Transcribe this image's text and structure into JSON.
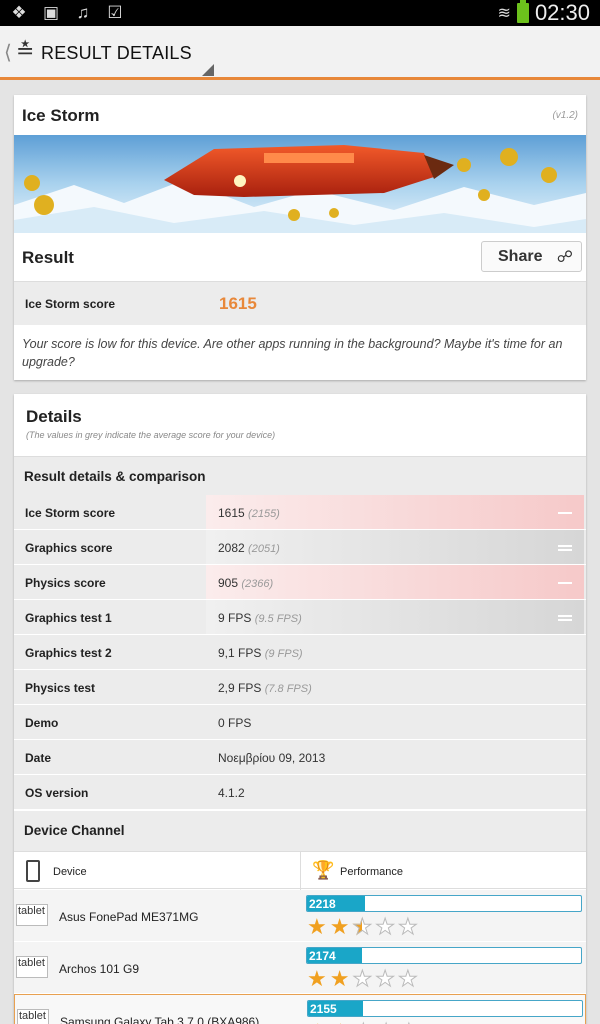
{
  "status_bar": {
    "left_icons": [
      "dropbox-icon",
      "gallery-icon",
      "music-icon",
      "checkbag-icon"
    ],
    "time": "02:30"
  },
  "action_bar": {
    "title": "RESULT DETAILS"
  },
  "test_card": {
    "title": "Ice Storm",
    "version": "(v1.2)",
    "result_label": "Result",
    "share_label": "Share",
    "score_label": "Ice Storm score",
    "score_value": "1615",
    "message": "Your score is low for this device. Are other apps running in the background? Maybe it's time for an upgrade?"
  },
  "details": {
    "title": "Details",
    "subtitle": "(The values in grey indicate the average score for your device)",
    "section_title": "Result details & comparison",
    "rows": [
      {
        "label": "Ice Storm score",
        "value": "1615",
        "avg": "(2155)"
      },
      {
        "label": "Graphics score",
        "value": "2082",
        "avg": "(2051)"
      },
      {
        "label": "Physics score",
        "value": "905",
        "avg": "(2366)"
      },
      {
        "label": "Graphics test 1",
        "value": "9 FPS",
        "avg": "(9.5 FPS)"
      },
      {
        "label": "Graphics test 2",
        "value": "9,1 FPS",
        "avg": "(9 FPS)"
      },
      {
        "label": "Physics test",
        "value": "2,9 FPS",
        "avg": "(7.8 FPS)"
      },
      {
        "label": "Demo",
        "value": "0 FPS",
        "avg": ""
      },
      {
        "label": "Date",
        "value": "Νοεμβρίου 09, 2013",
        "avg": ""
      },
      {
        "label": "OS version",
        "value": "4.1.2",
        "avg": ""
      }
    ]
  },
  "device_channel": {
    "title": "Device Channel",
    "col_device": "Device",
    "col_performance": "Performance",
    "thumb_alt": "tablet",
    "devices": [
      {
        "name": "Asus FonePad ME371MG",
        "score": "2218",
        "fill": 0.21,
        "rating": 2.5
      },
      {
        "name": "Archos 101 G9",
        "score": "2174",
        "fill": 0.2,
        "rating": 2
      },
      {
        "name": "Samsung Galaxy Tab 3 7.0 (BXA986)",
        "score": "2155",
        "fill": 0.2,
        "rating": 2
      }
    ]
  }
}
